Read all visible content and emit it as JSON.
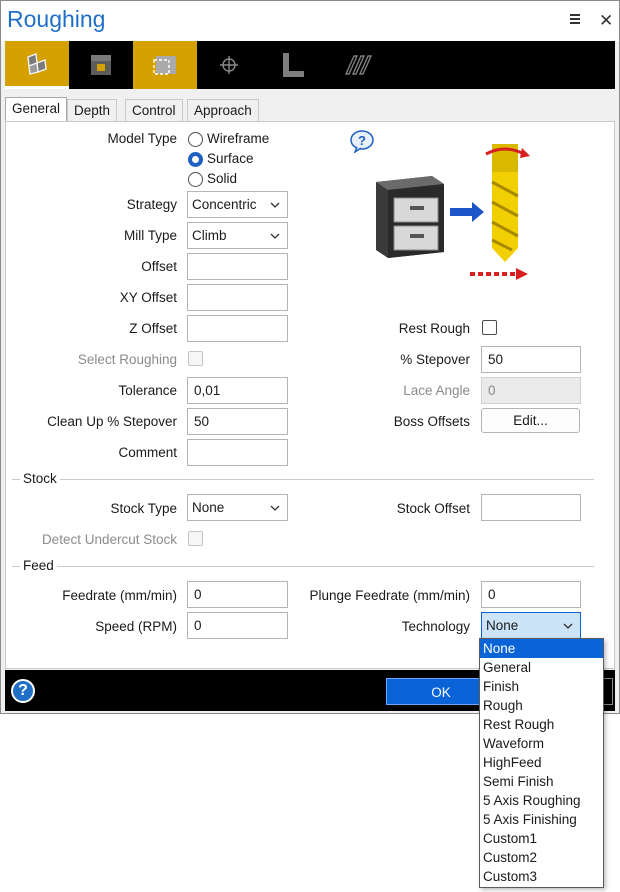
{
  "window": {
    "title": "Roughing"
  },
  "toolbar": {
    "buttons": [
      {
        "icon": "surface-roughing-icon"
      },
      {
        "icon": "stock-box-icon"
      },
      {
        "icon": "selection-box-icon"
      },
      {
        "icon": "crosshair-icon"
      },
      {
        "icon": "l-profile-icon"
      },
      {
        "icon": "waveform-path-icon"
      }
    ]
  },
  "tabs": [
    "General",
    "Depth",
    "Control",
    "Approach"
  ],
  "general": {
    "model_type": {
      "label": "Model Type",
      "options": [
        "Wireframe",
        "Surface",
        "Solid"
      ],
      "selected": "Surface"
    },
    "strategy": {
      "label": "Strategy",
      "value": "Concentric"
    },
    "mill_type": {
      "label": "Mill Type",
      "value": "Climb"
    },
    "offset": {
      "label": "Offset",
      "value": ""
    },
    "xy_offset": {
      "label": "XY Offset",
      "value": ""
    },
    "z_offset": {
      "label": "Z Offset",
      "value": ""
    },
    "select_roughing": {
      "label": "Select Roughing",
      "checked": false
    },
    "tolerance": {
      "label": "Tolerance",
      "value": "0,01"
    },
    "clean_up_stepover": {
      "label": "Clean Up % Stepover",
      "value": "50"
    },
    "comment": {
      "label": "Comment",
      "value": ""
    },
    "rest_rough": {
      "label": "Rest Rough",
      "checked": false
    },
    "stepover": {
      "label": "% Stepover",
      "value": "50"
    },
    "lace_angle": {
      "label": "Lace Angle",
      "value": "0"
    },
    "boss_offsets": {
      "label": "Boss Offsets",
      "button": "Edit..."
    }
  },
  "stock": {
    "section": "Stock",
    "stock_type": {
      "label": "Stock Type",
      "value": "None"
    },
    "stock_offset": {
      "label": "Stock Offset",
      "value": ""
    },
    "detect_undercut": {
      "label": "Detect Undercut Stock",
      "checked": false
    }
  },
  "feed": {
    "section": "Feed",
    "feedrate": {
      "label": "Feedrate (mm/min)",
      "value": "0"
    },
    "plunge_feedrate": {
      "label": "Plunge Feedrate (mm/min)",
      "value": "0"
    },
    "speed": {
      "label": "Speed (RPM)",
      "value": "0"
    },
    "technology": {
      "label": "Technology",
      "value": "None"
    }
  },
  "technology_options": [
    "None",
    "General",
    "Finish",
    "Rough",
    "Rest Rough",
    "Waveform",
    "HighFeed",
    "Semi Finish",
    "5 Axis Roughing",
    "5 Axis Finishing",
    "Custom1",
    "Custom2",
    "Custom3"
  ],
  "technology_highlighted": "None",
  "footer": {
    "ok_label": "OK"
  },
  "colors": {
    "accent": "#1f6fc6",
    "toolbar_active": "#d4a100",
    "selection": "#0a64d8"
  }
}
